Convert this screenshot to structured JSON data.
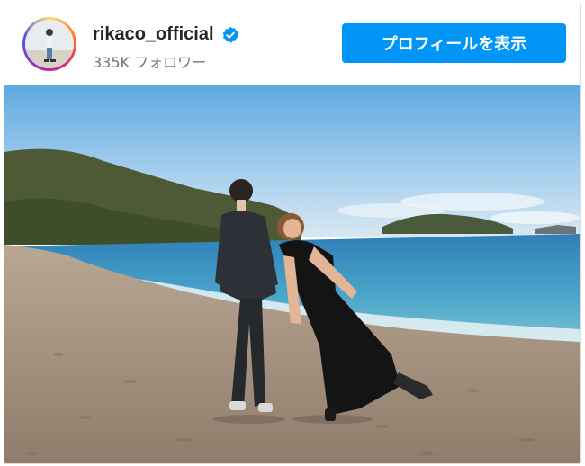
{
  "profile": {
    "username": "rikaco_official",
    "followers_text": "335K フォロワー",
    "verified": true,
    "avatar_icon": "profile-avatar",
    "verified_icon": "verified-badge-icon"
  },
  "actions": {
    "view_profile_label": "プロフィールを表示"
  },
  "colors": {
    "accent": "#0095f6",
    "verified": "#0095f6",
    "text_primary": "#262626",
    "text_secondary": "#737373"
  }
}
